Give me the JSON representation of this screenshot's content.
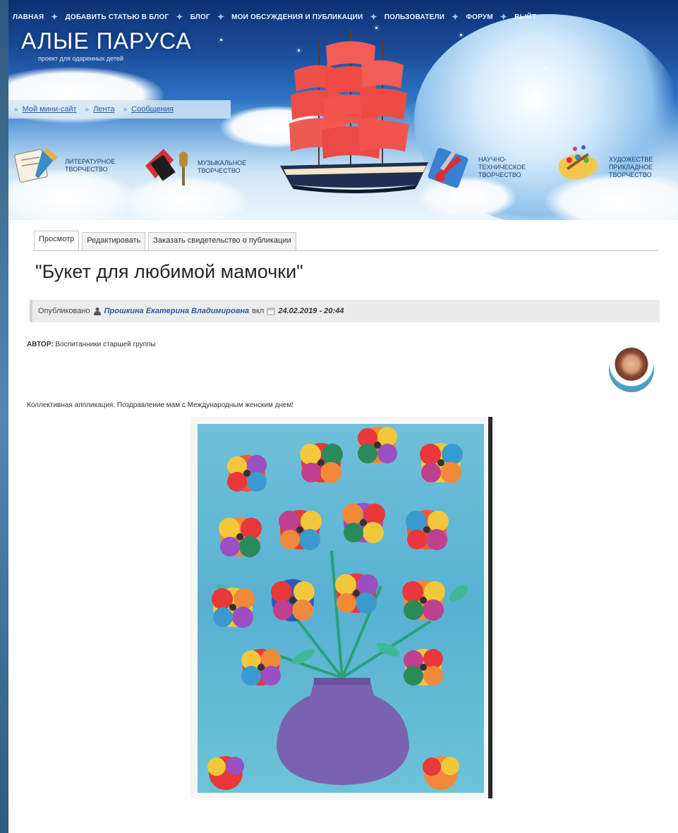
{
  "nav": {
    "items": [
      "ЛАВНАЯ",
      "ДОБАВИТЬ СТАТЬЮ В БЛОГ",
      "БЛОГ",
      "МОИ ОБСУЖДЕНИЯ И ПУБЛИКАЦИИ",
      "ПОЛЬЗОВАТЕЛИ",
      "ФОРУМ",
      "ВЫЙТ"
    ]
  },
  "site": {
    "title": "АЛЫЕ ПАРУСА",
    "subtitle": "проект для одаренных детей"
  },
  "subnav": {
    "items": [
      "Мой мини-сайт",
      "Лента",
      "Сообщения"
    ]
  },
  "categories": {
    "lit": [
      "ЛИТЕРАТУРНОЕ",
      "ТВОРЧЕСТВО"
    ],
    "music": [
      "МУЗЫКАЛЬНОЕ",
      "ТВОРЧЕСТВО"
    ],
    "tech": [
      "НАУЧНО-",
      "ТЕХНИЧЕСКОЕ",
      "ТВОРЧЕСТВО"
    ],
    "art": [
      "ХУДОЖЕСТВЕ",
      "ПРИКЛАДНОЕ",
      "ТВОРЧЕСТВО"
    ]
  },
  "tabs": [
    "Просмотр",
    "Редактировать",
    "Заказать свидетельство о публикации"
  ],
  "article": {
    "title": "\"Букет для любимой мамочки\"",
    "published_label": "Опубликовано",
    "author": "Прошкина Екатерина Владимировна",
    "on_label": "вкл",
    "date": "24.02.2019 - 20:44",
    "avtor_label": "АВТОР:",
    "avtor_value": "Воспитанники старшей группы",
    "description": "Коллективная аппликация. Поздравление мам с Международным женским днем!"
  },
  "colors": {
    "nav_text": "#e9f2ff",
    "link": "#2a5aa8",
    "sail": "#f0504a",
    "vase": "#7b62b0",
    "art_bg": "#5fb6d4"
  },
  "icons": [
    "user-icon",
    "calendar-icon",
    "quill-icon",
    "music-icon",
    "tools-icon",
    "palette-icon"
  ]
}
